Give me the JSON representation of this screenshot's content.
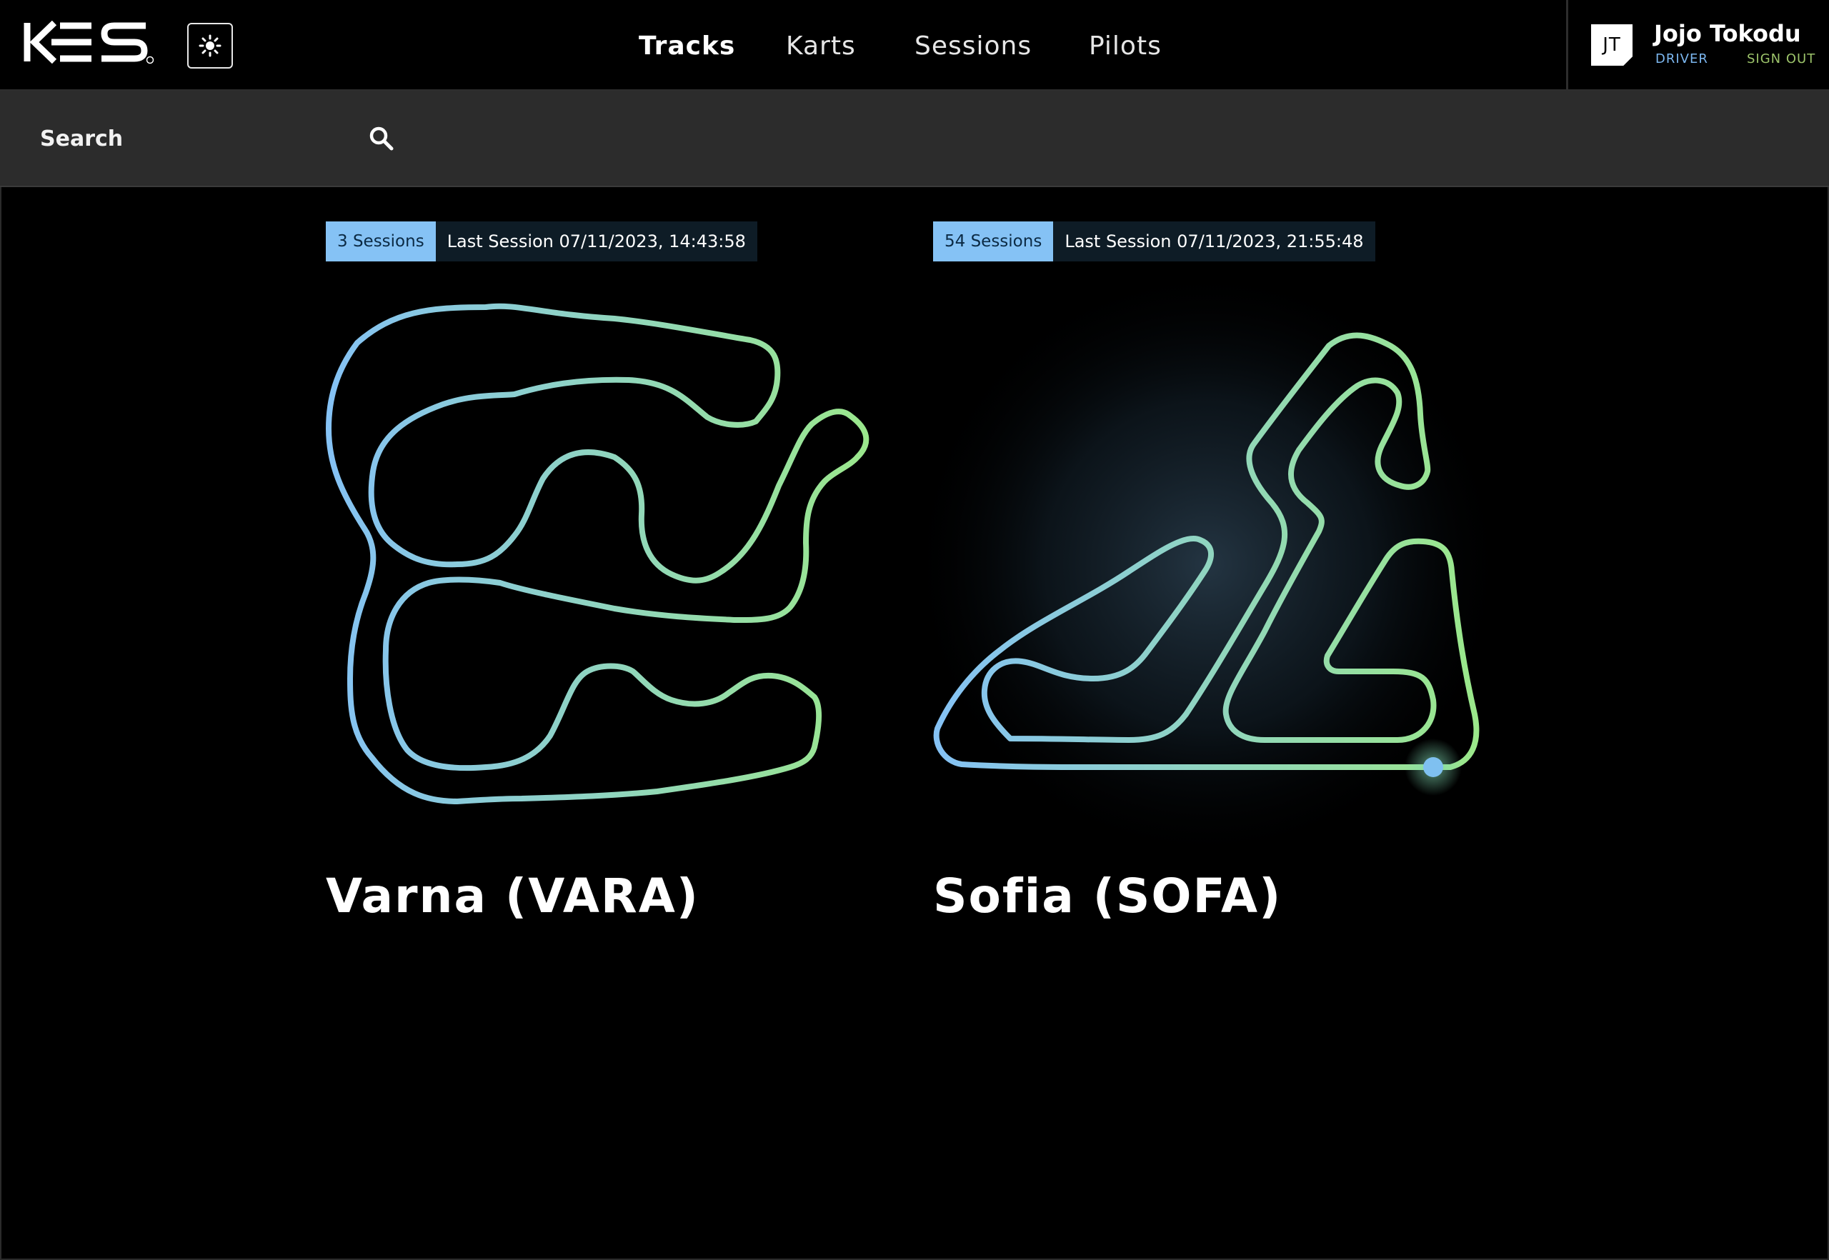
{
  "header": {
    "logo_text": "KES",
    "nav": [
      {
        "label": "Tracks",
        "active": true
      },
      {
        "label": "Karts",
        "active": false
      },
      {
        "label": "Sessions",
        "active": false
      },
      {
        "label": "Pilots",
        "active": false
      }
    ],
    "user": {
      "initials": "JT",
      "name": "Jojo Tokodu",
      "role": "DRIVER",
      "sign_out": "SIGN OUT"
    }
  },
  "search": {
    "placeholder": "Search"
  },
  "tracks": [
    {
      "name": "Varna (VARA)",
      "sessions": "3 Sessions",
      "last_session": "Last Session 07/11/2023, 14:43:58"
    },
    {
      "name": "Sofia (SOFA)",
      "sessions": "54 Sessions",
      "last_session": "Last Session 07/11/2023, 21:55:48"
    }
  ],
  "colors": {
    "accent_blue": "#85c2f5",
    "accent_green": "#9be88a",
    "background": "#000000",
    "searchbar": "#2c2c2c"
  }
}
